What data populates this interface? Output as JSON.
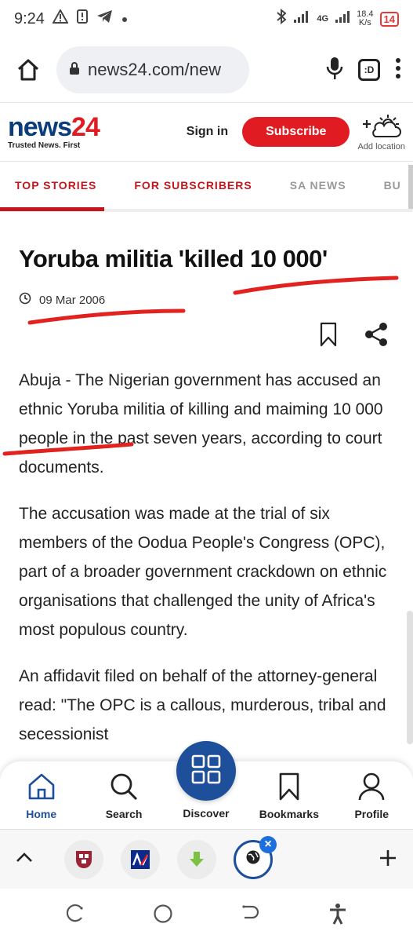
{
  "status_bar": {
    "time": "9:24",
    "network": "4G",
    "speed_value": "18.4",
    "speed_unit": "K/s",
    "battery": "14"
  },
  "browser": {
    "url": "news24.com/new",
    "tabs_label": ":D"
  },
  "site": {
    "logo_news": "news",
    "logo_24": "24",
    "tagline": "Trusted News. First",
    "signin": "Sign in",
    "subscribe": "Subscribe",
    "add_location": "Add location",
    "brand_red": "#e11b22",
    "brand_blue": "#0b3c7c"
  },
  "nav_tabs": [
    "TOP STORIES",
    "FOR SUBSCRIBERS",
    "SA NEWS",
    "BU"
  ],
  "article": {
    "headline": "Yoruba militia 'killed 10 000'",
    "date": "09 Mar 2006",
    "paragraphs": [
      "Abuja - The Nigerian government has accused an ethnic Yoruba militia of killing and maiming 10 000 people in the past seven years, according to court documents.",
      "The accusation was made at the trial of six members of the Oodua People's Congress (OPC), part of a broader government crackdown on ethnic organisations that challenged the unity of Africa's most populous country.",
      "An affidavit filed on behalf of the attorney-general read: \"The OPC is a callous, murderous, tribal and secessionist"
    ]
  },
  "bottom_nav": {
    "home": "Home",
    "search": "Search",
    "discover": "Discover",
    "bookmarks": "Bookmarks",
    "profile": "Profile"
  }
}
